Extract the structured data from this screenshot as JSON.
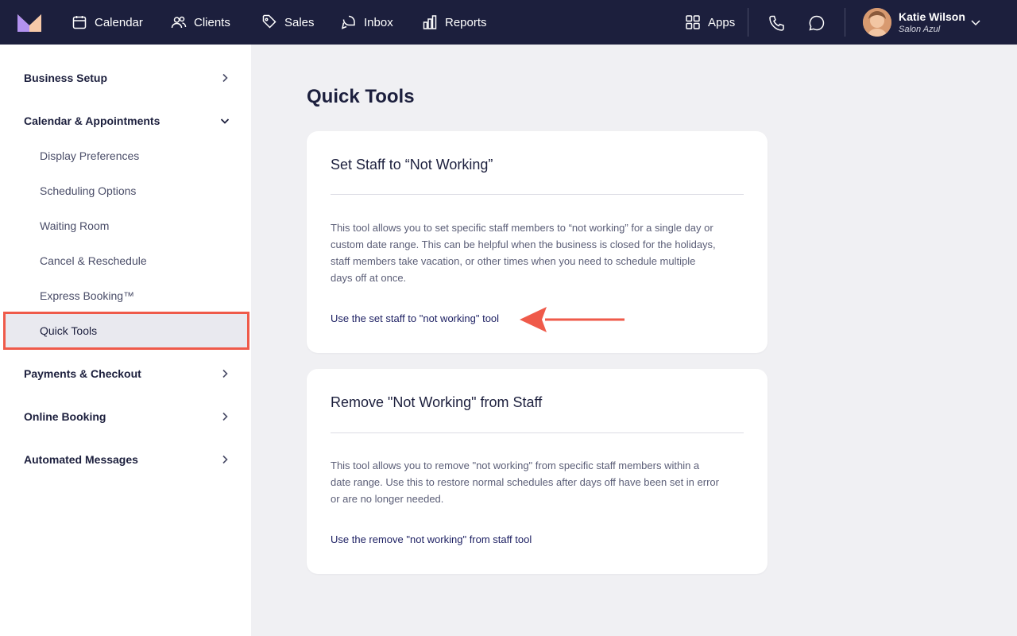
{
  "nav": {
    "items": [
      {
        "label": "Calendar",
        "icon": "calendar-icon"
      },
      {
        "label": "Clients",
        "icon": "clients-icon"
      },
      {
        "label": "Sales",
        "icon": "tag-icon"
      },
      {
        "label": "Inbox",
        "icon": "inbox-icon"
      },
      {
        "label": "Reports",
        "icon": "reports-icon"
      }
    ],
    "apps_label": "Apps",
    "user": {
      "name": "Katie Wilson",
      "business": "Salon Azul"
    }
  },
  "sidebar": {
    "business_setup": "Business Setup",
    "calendar_appointments": "Calendar & Appointments",
    "sub_items": [
      "Display Preferences",
      "Scheduling Options",
      "Waiting Room",
      "Cancel & Reschedule",
      "Express Booking™",
      "Quick Tools"
    ],
    "active_item": "Quick Tools",
    "payments_checkout": "Payments & Checkout",
    "online_booking": "Online Booking",
    "automated_messages": "Automated Messages"
  },
  "main": {
    "title": "Quick Tools",
    "cards": [
      {
        "title": "Set Staff to “Not Working”",
        "description": "This tool allows you to set specific staff members to “not working” for a single day or custom date range. This can be helpful when the business is closed for the holidays, staff members take vacation, or other times when you need to schedule multiple days off at once.",
        "link": "Use the set staff to \"not working\" tool"
      },
      {
        "title": "Remove \"Not Working\" from Staff",
        "description": "This tool allows you to remove \"not working\" from specific staff members within a date range. Use this to restore normal schedules after days off have been set in error or are no longer needed.",
        "link": "Use the remove \"not working\" from staff tool"
      }
    ]
  },
  "colors": {
    "nav_bg": "#1c1f3d",
    "highlight": "#ef5a4a",
    "active_bg": "#e9e9ef"
  }
}
